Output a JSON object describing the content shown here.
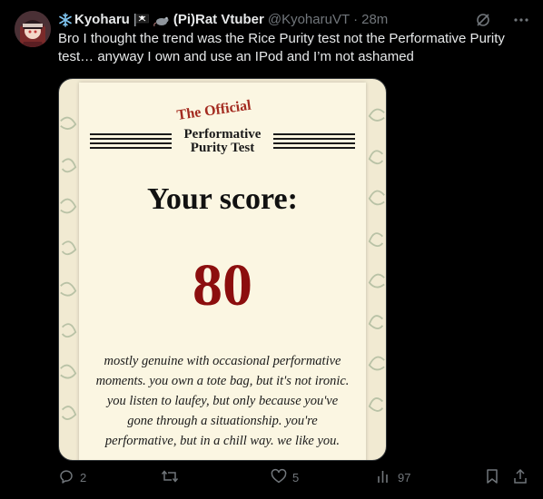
{
  "post": {
    "author": {
      "display_name": "Kyoharu",
      "name_suffix": "(Pi)Rat Vtuber",
      "handle": "@KyoharuVT",
      "separator": "·",
      "time": "28m"
    },
    "text": "Bro I thought the trend was the Rice Purity test not the Performative Purity test… anyway I own and use an IPod and I’m not ashamed",
    "media": {
      "logo_small": "The Official",
      "logo_line1": "Performative",
      "logo_line2": "Purity Test",
      "heading": "Your score:",
      "score": "80",
      "description": "mostly genuine with occasional performative moments. you own a tote bag, but it's not ironic. you listen to laufey, but only because you've gone through a situationship. you're performative, but in a chill way. we like you."
    },
    "actions": {
      "replies": "2",
      "reposts": "",
      "likes": "5",
      "views": "97"
    },
    "icons": {
      "verified": "snowflake-icon",
      "grok": "grok-icon",
      "more": "more-icon",
      "reply": "reply-icon",
      "repost": "repost-icon",
      "like": "like-icon",
      "views": "views-icon",
      "bookmark": "bookmark-icon",
      "share": "share-icon"
    },
    "colors": {
      "background": "#000000",
      "text": "#e7e9ea",
      "muted": "#71767b",
      "score_red": "#8c0e0e",
      "logo_red": "#a32a1f"
    }
  }
}
